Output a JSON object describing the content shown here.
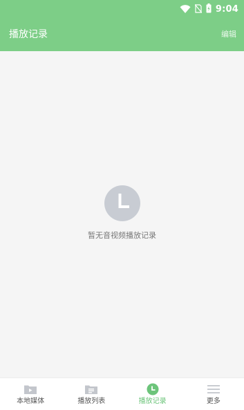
{
  "status_bar": {
    "time": "9:04",
    "icons": [
      "wifi-icon",
      "no-sim-icon",
      "battery-icon"
    ]
  },
  "header": {
    "title": "播放记录",
    "edit_label": "编辑"
  },
  "empty_state": {
    "icon": "clock-icon",
    "message": "暂无音视频播放记录"
  },
  "bottom_nav": {
    "items": [
      {
        "label": "本地媒体",
        "icon": "video-folder-icon",
        "active": false
      },
      {
        "label": "播放列表",
        "icon": "playlist-folder-icon",
        "active": false
      },
      {
        "label": "播放记录",
        "icon": "clock-icon",
        "active": true
      },
      {
        "label": "更多",
        "icon": "menu-icon",
        "active": false
      }
    ]
  },
  "colors": {
    "accent": "#7dce87",
    "active_nav": "#6cc47a",
    "empty_icon": "#c8ccd3"
  }
}
